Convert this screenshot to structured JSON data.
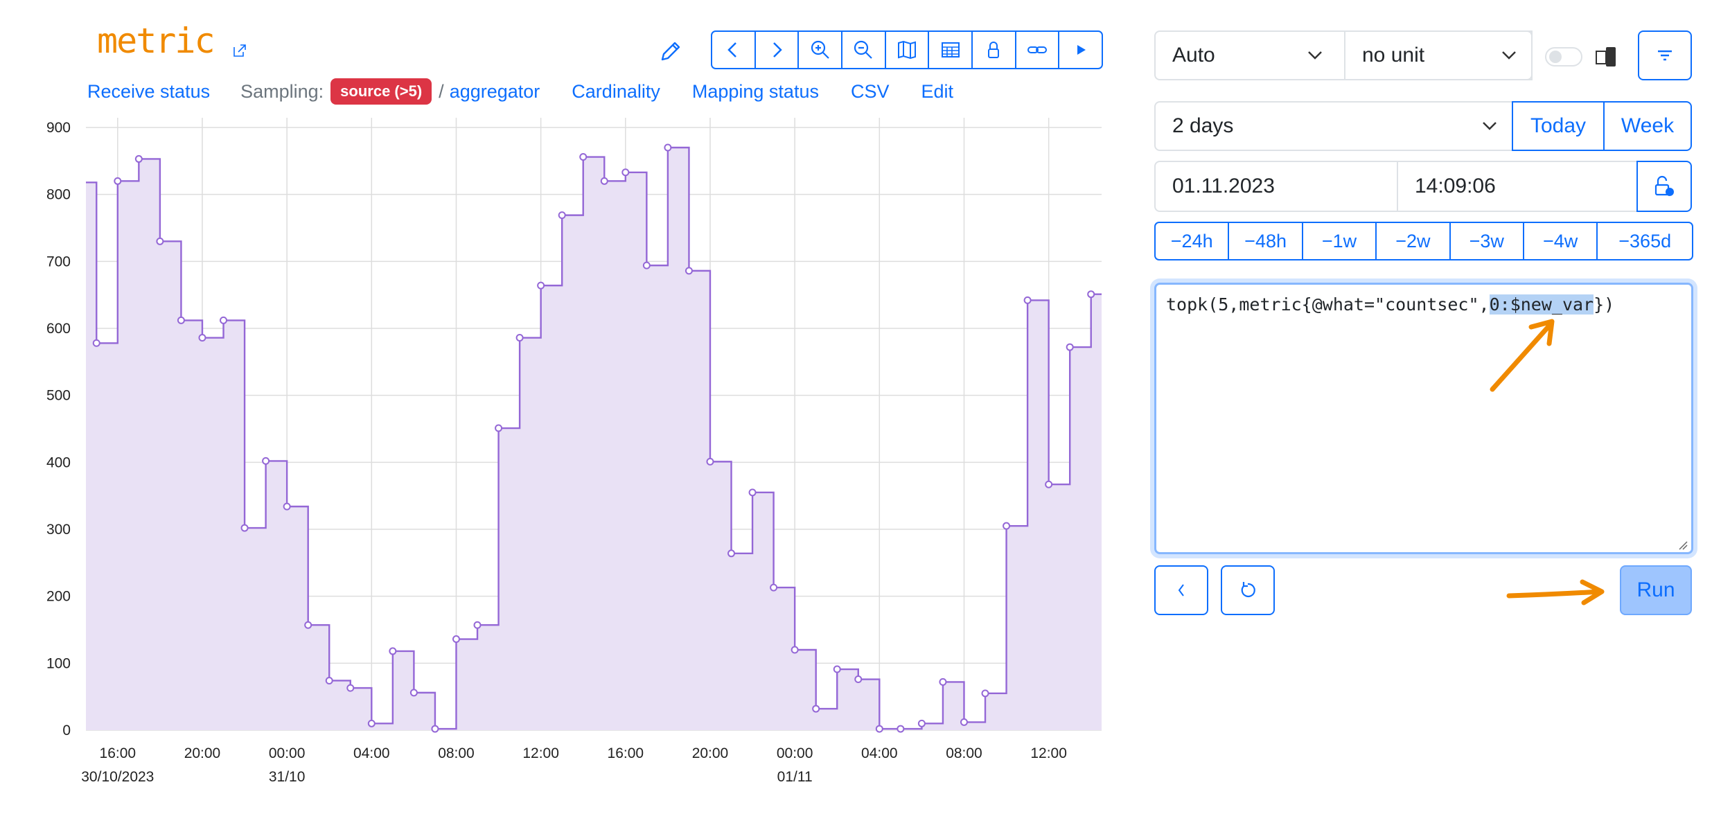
{
  "header": {
    "title": "metric",
    "links": {
      "receive_status": "Receive status",
      "sampling_label": "Sampling:",
      "sampling_badge": "source (>5)",
      "slash": "/",
      "aggregator": "aggregator",
      "cardinality": "Cardinality",
      "mapping_status": "Mapping status",
      "csv": "CSV",
      "edit": "Edit"
    },
    "toolbar_icons": [
      "chevron-left-icon",
      "chevron-right-icon",
      "zoom-in-icon",
      "zoom-out-icon",
      "map-icon",
      "table-icon",
      "lock-icon",
      "link-icon",
      "play-icon"
    ]
  },
  "controls": {
    "what_select": "Auto",
    "unit_select": "no unit",
    "period_select": "2 days",
    "today": "Today",
    "week": "Week",
    "date": "01.11.2023",
    "time": "14:09:06",
    "shifts": [
      "−24h",
      "−48h",
      "−1w",
      "−2w",
      "−3w",
      "−4w",
      "−365d"
    ],
    "query_prefix": "topk(5,metric{@what=\"countsec\",",
    "query_selected": "0:$new_var",
    "query_suffix": "})",
    "run": "Run"
  },
  "colors": {
    "accent": "#0d6efd",
    "series": "#9467d6",
    "series_fill": "#e9e1f5",
    "badge": "#dc3545",
    "annotation": "#f08a00"
  },
  "chart_data": {
    "type": "line",
    "step": true,
    "ylim": [
      0,
      900
    ],
    "yticks": [
      0,
      100,
      200,
      300,
      400,
      500,
      600,
      700,
      800,
      900
    ],
    "xlim": [
      14.5,
      62.5
    ],
    "xticks": [
      {
        "x": 16,
        "label": "16:00",
        "sub": "30/10/2023"
      },
      {
        "x": 20,
        "label": "20:00",
        "sub": ""
      },
      {
        "x": 24,
        "label": "00:00",
        "sub": "31/10"
      },
      {
        "x": 28,
        "label": "04:00",
        "sub": ""
      },
      {
        "x": 32,
        "label": "08:00",
        "sub": ""
      },
      {
        "x": 36,
        "label": "12:00",
        "sub": ""
      },
      {
        "x": 40,
        "label": "16:00",
        "sub": ""
      },
      {
        "x": 44,
        "label": "20:00",
        "sub": ""
      },
      {
        "x": 48,
        "label": "00:00",
        "sub": "01/11"
      },
      {
        "x": 52,
        "label": "04:00",
        "sub": ""
      },
      {
        "x": 56,
        "label": "08:00",
        "sub": ""
      },
      {
        "x": 60,
        "label": "12:00",
        "sub": ""
      }
    ],
    "points": [
      [
        14.5,
        818
      ],
      [
        15.0,
        578
      ],
      [
        16.0,
        820
      ],
      [
        17.0,
        853
      ],
      [
        18.0,
        730
      ],
      [
        19.0,
        612
      ],
      [
        20.0,
        586
      ],
      [
        21.0,
        612
      ],
      [
        22.0,
        302
      ],
      [
        23.0,
        402
      ],
      [
        24.0,
        334
      ],
      [
        25.0,
        157
      ],
      [
        26.0,
        74
      ],
      [
        27.0,
        63
      ],
      [
        28.0,
        10
      ],
      [
        29.0,
        118
      ],
      [
        30.0,
        56
      ],
      [
        31.0,
        2
      ],
      [
        32.0,
        136
      ],
      [
        33.0,
        157
      ],
      [
        34.0,
        451
      ],
      [
        35.0,
        586
      ],
      [
        36.0,
        664
      ],
      [
        37.0,
        769
      ],
      [
        38.0,
        856
      ],
      [
        39.0,
        820
      ],
      [
        40.0,
        833
      ],
      [
        41.0,
        694
      ],
      [
        42.0,
        870
      ],
      [
        43.0,
        686
      ],
      [
        44.0,
        401
      ],
      [
        45.0,
        264
      ],
      [
        46.0,
        355
      ],
      [
        47.0,
        213
      ],
      [
        48.0,
        120
      ],
      [
        49.0,
        32
      ],
      [
        50.0,
        91
      ],
      [
        51.0,
        76
      ],
      [
        52.0,
        2
      ],
      [
        53.0,
        2
      ],
      [
        54.0,
        10
      ],
      [
        55.0,
        72
      ],
      [
        56.0,
        12
      ],
      [
        57.0,
        55
      ],
      [
        58.0,
        305
      ],
      [
        59.0,
        642
      ],
      [
        60.0,
        367
      ],
      [
        61.0,
        572
      ],
      [
        62.0,
        651
      ]
    ]
  }
}
